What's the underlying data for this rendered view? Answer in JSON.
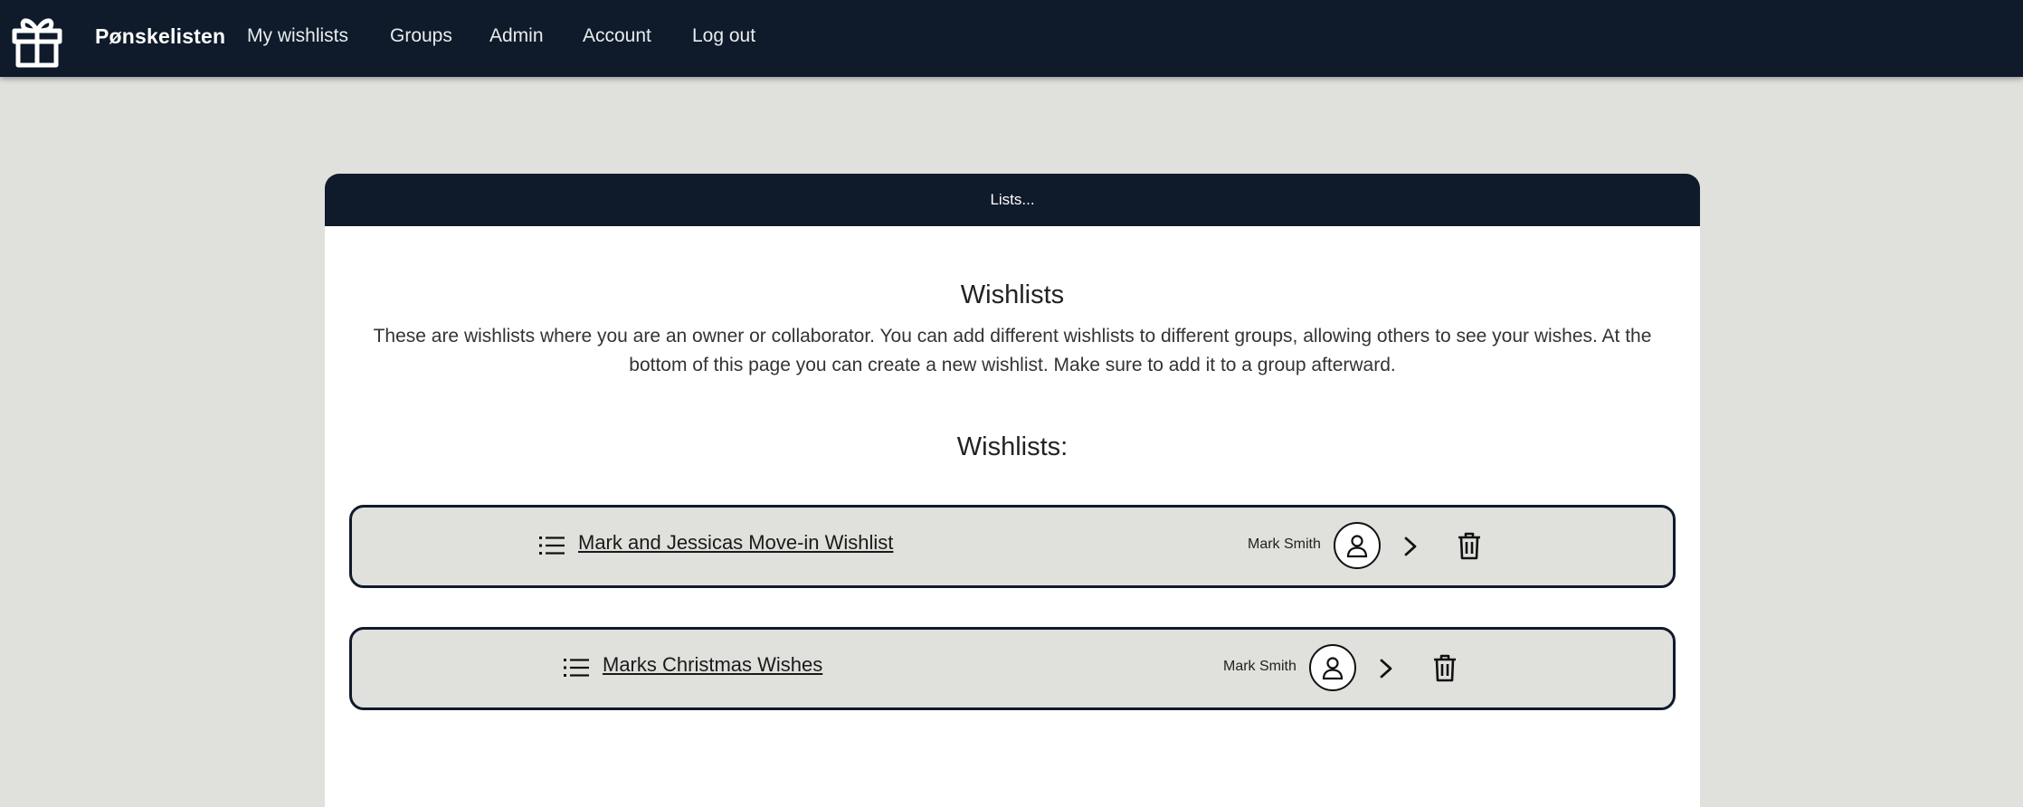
{
  "nav": {
    "brand": "Pønskelisten",
    "links": [
      "My wishlists",
      "Groups",
      "Admin",
      "Account",
      "Log out"
    ]
  },
  "card": {
    "header": "Lists...",
    "title": "Wishlists",
    "description": "These are wishlists where you are an owner or collaborator. You can add different wishlists to different groups, allowing others to see your wishes. At the bottom of this page you can create a new wishlist. Make sure to add it to a group afterward.",
    "subtitle": "Wishlists:"
  },
  "wishlists": [
    {
      "name": "Mark and Jessicas Move-in Wishlist",
      "owner": "Mark Smith"
    },
    {
      "name": "Marks Christmas Wishes",
      "owner": "Mark Smith"
    }
  ],
  "icons": {
    "logo": "gift-icon",
    "list": "list-icon",
    "avatar": "user-icon",
    "open": "chevron-right-icon",
    "delete": "trash-icon"
  },
  "colors": {
    "navbar": "#0f1b2a",
    "background": "#e0e0dc",
    "card": "#ffffff"
  }
}
